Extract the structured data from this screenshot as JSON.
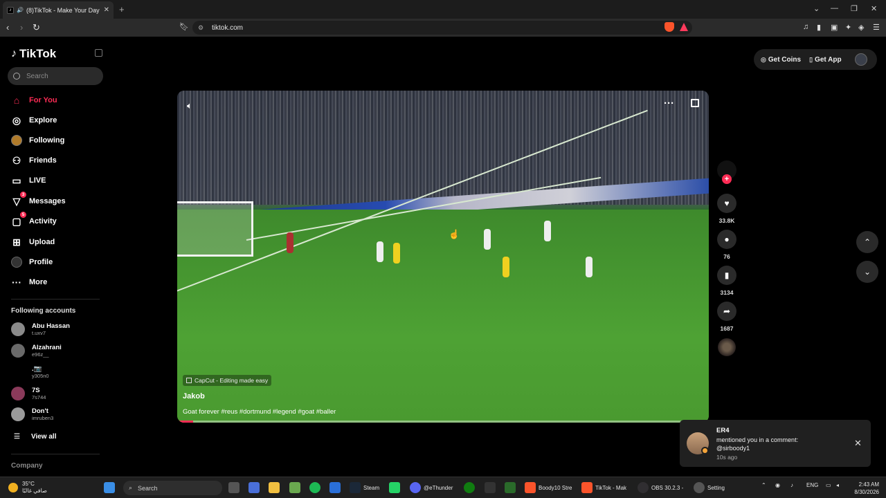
{
  "browser": {
    "tab_title": "(8)TikTok - Make Your Day",
    "url": "tiktok.com"
  },
  "sidebar": {
    "brand": "TikTok",
    "search_placeholder": "Search",
    "nav": [
      {
        "label": "For You",
        "icon": "home-icon",
        "active": true
      },
      {
        "label": "Explore",
        "icon": "compass-icon"
      },
      {
        "label": "Following",
        "icon": "following-avatar-icon"
      },
      {
        "label": "Friends",
        "icon": "friends-icon"
      },
      {
        "label": "LIVE",
        "icon": "live-icon"
      },
      {
        "label": "Messages",
        "icon": "paper-plane-icon",
        "badge": "3"
      },
      {
        "label": "Activity",
        "icon": "chat-bubble-icon",
        "badge": "5"
      },
      {
        "label": "Upload",
        "icon": "plus-square-icon"
      },
      {
        "label": "Profile",
        "icon": "profile-avatar-icon"
      },
      {
        "label": "More",
        "icon": "ellipsis-icon"
      }
    ],
    "following_title": "Following accounts",
    "accounts": [
      {
        "name": "Abu Hassan",
        "handle": "t.uxv7"
      },
      {
        "name": "Alzahrani",
        "handle": "e96z__"
      },
      {
        "name": ".📷",
        "handle": "y305n0"
      },
      {
        "name": "7S",
        "handle": "7s744"
      },
      {
        "name": "Don't",
        "handle": "imruben3"
      }
    ],
    "view_all": "View all",
    "company": "Company"
  },
  "topbar": {
    "get_coins": "Get Coins",
    "get_app": "Get App"
  },
  "video": {
    "capcut": "CapCut - Editing made easy",
    "author": "Jakob",
    "description": "Goat forever #reus #dortmund #legend #goat #baller",
    "progress": 0.03
  },
  "actions": {
    "likes": "33.8K",
    "comments": "76",
    "saves": "3134",
    "shares": "1687"
  },
  "notification": {
    "title": "ER4",
    "body": "mentioned you in a comment: @sirboody1",
    "time": "10s ago"
  },
  "taskbar": {
    "temp": "35°C",
    "weather_desc": "صافي غالبًا",
    "search": "Search",
    "apps": [
      "Steam",
      "@eThunder",
      "Boody10 Stre",
      "TikTok - Mak",
      "OBS 30.2.3 -",
      "Setting"
    ],
    "lang": "ENG",
    "time": "2:43 AM",
    "date": "8/30/2026"
  },
  "colors": {
    "accent": "#fe2c55",
    "background": "#000000"
  }
}
